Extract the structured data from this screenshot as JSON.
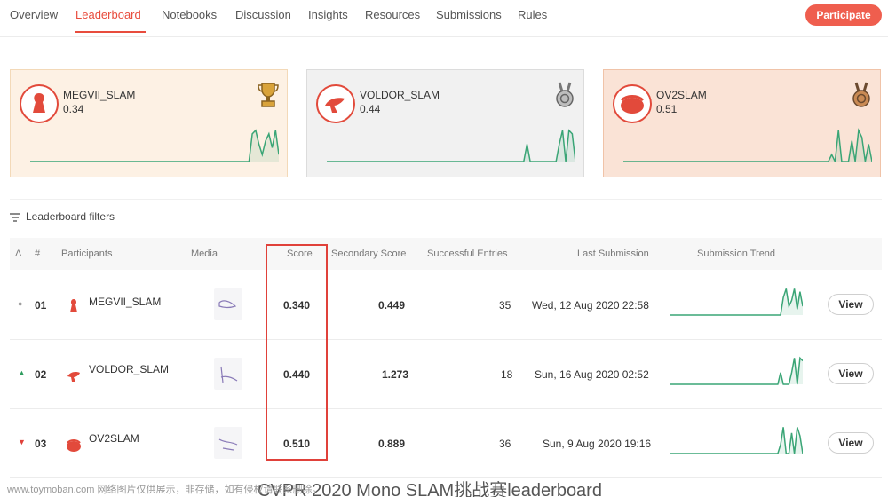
{
  "nav": {
    "tabs": [
      "Overview",
      "Leaderboard",
      "Notebooks",
      "Discussion",
      "Insights",
      "Resources",
      "Submissions",
      "Rules"
    ],
    "active_tab": "Leaderboard",
    "participate_label": "Participate"
  },
  "podium": [
    {
      "name": "MEGVII_SLAM",
      "score": "0.34",
      "medal": "gold-trophy-icon",
      "trend": [
        0,
        0,
        0,
        0,
        0,
        0,
        0,
        0,
        0,
        0,
        0,
        0,
        0,
        0,
        0,
        0,
        0,
        0,
        0,
        0,
        0,
        0,
        0,
        0,
        0,
        0,
        0,
        0,
        0,
        0,
        0,
        0,
        0,
        0,
        0,
        0,
        0,
        0,
        0,
        0,
        0,
        0,
        0,
        0,
        0,
        0,
        0,
        0,
        0,
        0,
        0,
        0,
        0,
        0,
        0,
        0,
        0,
        0,
        0,
        0,
        0,
        0,
        0,
        0,
        0,
        0,
        0,
        0.8,
        0.9,
        0.5,
        0.2,
        0.6,
        0.8,
        0.4,
        0.9,
        0.2
      ]
    },
    {
      "name": "VOLDOR_SLAM",
      "score": "0.44",
      "medal": "silver-medal-icon",
      "trend": [
        0,
        0,
        0,
        0,
        0,
        0,
        0,
        0,
        0,
        0,
        0,
        0,
        0,
        0,
        0,
        0,
        0,
        0,
        0,
        0,
        0,
        0,
        0,
        0,
        0,
        0,
        0,
        0,
        0,
        0,
        0,
        0,
        0,
        0,
        0,
        0,
        0,
        0,
        0,
        0,
        0,
        0,
        0,
        0,
        0,
        0,
        0,
        0,
        0,
        0,
        0,
        0,
        0,
        0,
        0,
        0,
        0,
        0,
        0,
        0,
        0,
        0,
        0.5,
        0,
        0,
        0,
        0,
        0,
        0,
        0,
        0,
        0,
        0.5,
        0.9,
        0,
        0.9,
        0.8,
        0
      ]
    },
    {
      "name": "OV2SLAM",
      "score": "0.51",
      "medal": "bronze-medal-icon",
      "trend": [
        0,
        0,
        0,
        0,
        0,
        0,
        0,
        0,
        0,
        0,
        0,
        0,
        0,
        0,
        0,
        0,
        0,
        0,
        0,
        0,
        0,
        0,
        0,
        0,
        0,
        0,
        0,
        0,
        0,
        0,
        0,
        0,
        0,
        0,
        0,
        0,
        0,
        0,
        0,
        0,
        0,
        0,
        0,
        0,
        0,
        0,
        0,
        0,
        0,
        0,
        0,
        0,
        0,
        0,
        0,
        0,
        0,
        0,
        0,
        0,
        0,
        0,
        0.2,
        0,
        0.9,
        0,
        0,
        0,
        0.6,
        0,
        0.9,
        0.7,
        0,
        0.5,
        0
      ]
    }
  ],
  "filters_label": "Leaderboard filters",
  "table": {
    "headers": {
      "delta": "Δ",
      "rank": "#",
      "participants": "Participants",
      "media": "Media",
      "score": "Score",
      "secondary": "Secondary Score",
      "entries": "Successful Entries",
      "last": "Last Submission",
      "trend": "Submission Trend"
    },
    "rows": [
      {
        "change": "same",
        "change_color": "#9e9e9e",
        "rank": "01",
        "participant": "MEGVII_SLAM",
        "score": "0.340",
        "secondary": "0.449",
        "entries": "35",
        "last_submission": "Wed, 12 Aug 2020 22:58",
        "view_label": "View",
        "trend": [
          0,
          0,
          0,
          0,
          0,
          0,
          0,
          0,
          0,
          0,
          0,
          0,
          0,
          0,
          0,
          0,
          0,
          0,
          0,
          0,
          0,
          0,
          0,
          0,
          0,
          0,
          0,
          0,
          0,
          0,
          0,
          0,
          0,
          0,
          0,
          0,
          0,
          0,
          0,
          0,
          0,
          0.6,
          0.9,
          0.3,
          0.5,
          0.9,
          0.2,
          0.8,
          0.3
        ]
      },
      {
        "change": "up",
        "change_color": "#2e9c5e",
        "rank": "02",
        "participant": "VOLDOR_SLAM",
        "score": "0.440",
        "secondary": "1.273",
        "entries": "18",
        "last_submission": "Sun, 16 Aug 2020 02:52",
        "view_label": "View",
        "trend": [
          0,
          0,
          0,
          0,
          0,
          0,
          0,
          0,
          0,
          0,
          0,
          0,
          0,
          0,
          0,
          0,
          0,
          0,
          0,
          0,
          0,
          0,
          0,
          0,
          0,
          0,
          0,
          0,
          0,
          0,
          0,
          0,
          0,
          0,
          0,
          0,
          0,
          0,
          0,
          0,
          0.4,
          0,
          0,
          0,
          0.4,
          0.9,
          0,
          0.9,
          0.8
        ]
      },
      {
        "change": "down",
        "change_color": "#e0413a",
        "rank": "03",
        "participant": "OV2SLAM",
        "score": "0.510",
        "secondary": "0.889",
        "entries": "36",
        "last_submission": "Sun, 9 Aug 2020 19:16",
        "view_label": "View",
        "trend": [
          0,
          0,
          0,
          0,
          0,
          0,
          0,
          0,
          0,
          0,
          0,
          0,
          0,
          0,
          0,
          0,
          0,
          0,
          0,
          0,
          0,
          0,
          0,
          0,
          0,
          0,
          0,
          0,
          0,
          0,
          0,
          0,
          0,
          0,
          0,
          0,
          0,
          0,
          0,
          0,
          0.3,
          0.9,
          0,
          0,
          0.7,
          0,
          0.9,
          0.6,
          0
        ]
      }
    ]
  },
  "colors": {
    "accent": "#e84c3d",
    "trend_line": "#3aa576",
    "score_box": "#e0413a"
  },
  "caption": "CVPR 2020 Mono SLAM挑战赛leaderboard",
  "watermark": "www.toymoban.com 网络图片仅供展示，非存储，如有侵权请联系删除。"
}
